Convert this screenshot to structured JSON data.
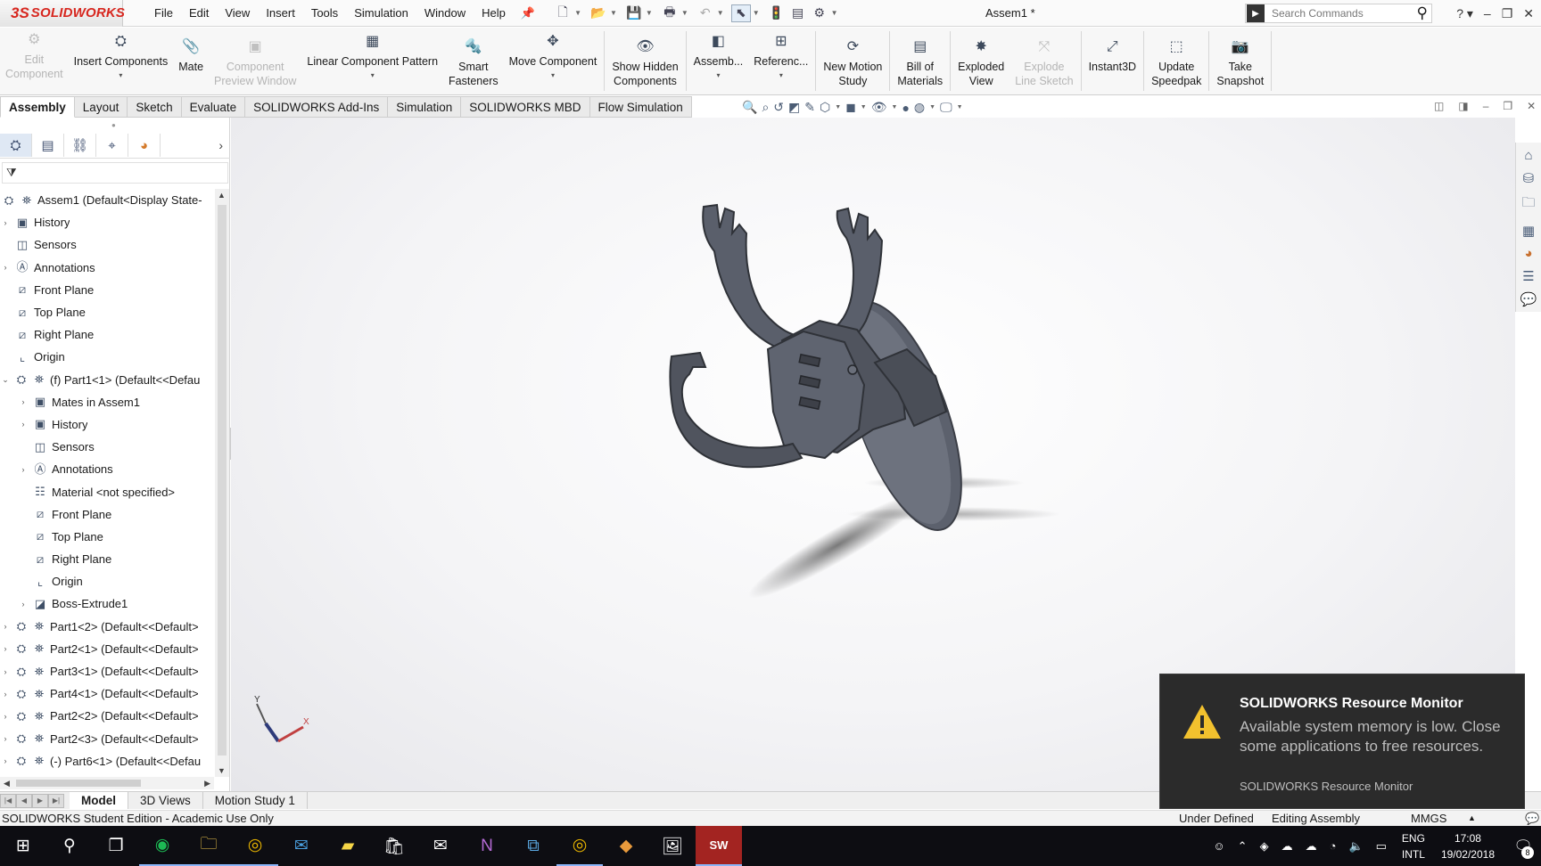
{
  "app": {
    "logo_mark": "3S",
    "logo_text": "SOLIDWORKS",
    "document_title": "Assem1 *"
  },
  "menu": [
    "File",
    "Edit",
    "View",
    "Insert",
    "Tools",
    "Simulation",
    "Window",
    "Help"
  ],
  "search": {
    "placeholder": "Search Commands"
  },
  "commands": {
    "edit_component": {
      "line1": "Edit",
      "line2": "Component"
    },
    "insert_components": "Insert Components",
    "mate": "Mate",
    "component_preview": {
      "line1": "Component",
      "line2": "Preview Window"
    },
    "linear_pattern": "Linear Component Pattern",
    "smart_fasteners": {
      "line1": "Smart",
      "line2": "Fasteners"
    },
    "move_component": "Move Component",
    "show_hidden": {
      "line1": "Show Hidden",
      "line2": "Components"
    },
    "assembly": "Assemb...",
    "reference": "Referenc...",
    "motion_study": {
      "line1": "New Motion",
      "line2": "Study"
    },
    "bom": {
      "line1": "Bill of",
      "line2": "Materials"
    },
    "exploded": {
      "line1": "Exploded",
      "line2": "View"
    },
    "explode_line": {
      "line1": "Explode",
      "line2": "Line Sketch"
    },
    "instant3d": "Instant3D",
    "speedpak": {
      "line1": "Update",
      "line2": "Speedpak"
    },
    "snapshot": {
      "line1": "Take",
      "line2": "Snapshot"
    }
  },
  "tabs": [
    "Assembly",
    "Layout",
    "Sketch",
    "Evaluate",
    "SOLIDWORKS Add-Ins",
    "Simulation",
    "SOLIDWORKS MBD",
    "Flow Simulation"
  ],
  "tree": {
    "root": "Assem1  (Default<Display State-",
    "items": [
      "History",
      "Sensors",
      "Annotations",
      "Front Plane",
      "Top Plane",
      "Right Plane",
      "Origin",
      "(f) Part1<1> (Default<<Defau",
      "Mates in Assem1",
      "History",
      "Sensors",
      "Annotations",
      "Material <not specified>",
      "Front Plane",
      "Top Plane",
      "Right Plane",
      "Origin",
      "Boss-Extrude1",
      "Part1<2> (Default<<Default>",
      "Part2<1> (Default<<Default>",
      "Part3<1> (Default<<Default>",
      "Part4<1> (Default<<Default>",
      "Part2<2> (Default<<Default>",
      "Part2<3> (Default<<Default>",
      "(-) Part6<1> (Default<<Defau"
    ]
  },
  "triad": {
    "y": "Y",
    "x": "X"
  },
  "bottom_tabs": [
    "Model",
    "3D Views",
    "Motion Study 1"
  ],
  "status": {
    "left": "SOLIDWORKS Student Edition - Academic Use Only",
    "defined": "Under Defined",
    "mode": "Editing Assembly",
    "units": "MMGS",
    "units_caret": "▲"
  },
  "notification": {
    "title": "SOLIDWORKS Resource Monitor",
    "body": "Available system memory is low. Close some applications to free resources.",
    "source": "SOLIDWORKS Resource Monitor"
  },
  "taskbar": {
    "lang1": "ENG",
    "lang2": "INTL",
    "time": "17:08",
    "date": "19/02/2018",
    "notification_count": "8",
    "sw_icon_text": "SW"
  },
  "colors": {
    "accent": "#d7261e",
    "model": "#5a5f6b",
    "toast_bg": "#2b2b2b",
    "taskbar": "#0d0d12"
  }
}
